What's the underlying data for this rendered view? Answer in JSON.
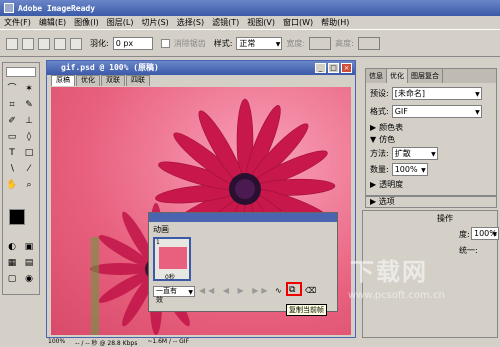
{
  "app": {
    "title": "Adobe ImageReady"
  },
  "menu": [
    "文件(F)",
    "编辑(E)",
    "图像(I)",
    "图层(L)",
    "切片(S)",
    "选择(S)",
    "滤镜(T)",
    "视图(V)",
    "窗口(W)",
    "帮助(H)"
  ],
  "options": {
    "feather_label": "羽化:",
    "feather_value": "0 px",
    "antialias_label": "消除锯齿",
    "style_label": "样式:",
    "style_value": "正常",
    "width_label": "宽度:",
    "height_label": "高度:"
  },
  "document": {
    "title": "gif.psd @ 100% (原稿)",
    "tabs": [
      "原稿",
      "优化",
      "双联",
      "四联"
    ],
    "status_zoom": "100%",
    "status_speed": "-- / -- 秒 @ 28.8 Kbps",
    "status_format": "~1.6M / -- GIF"
  },
  "optimize_panel": {
    "tabs": [
      "信息",
      "优化",
      "图层复合"
    ],
    "preset_label": "预设:",
    "preset_value": "[未命名]",
    "format_label": "格式:",
    "format_value": "GIF",
    "color_table": "颜色表",
    "dither_header": "仿色",
    "method_label": "方法:",
    "method_value": "扩散",
    "amount_label": "数量:",
    "amount_value": "100%",
    "transparency": "透明度",
    "options": "选项"
  },
  "animation": {
    "title": "动画",
    "frame_number": "1",
    "frame_delay": "0秒",
    "loop_value": "一直有效",
    "tooltip": "复制当前帧"
  },
  "layers_panel": {
    "tab_partial": "操作",
    "opacity_label": "度:",
    "opacity_value": "100%",
    "unify_label": "统一:"
  },
  "watermark": {
    "text": "下载网",
    "url": "www.pcsoft.com.cn"
  }
}
